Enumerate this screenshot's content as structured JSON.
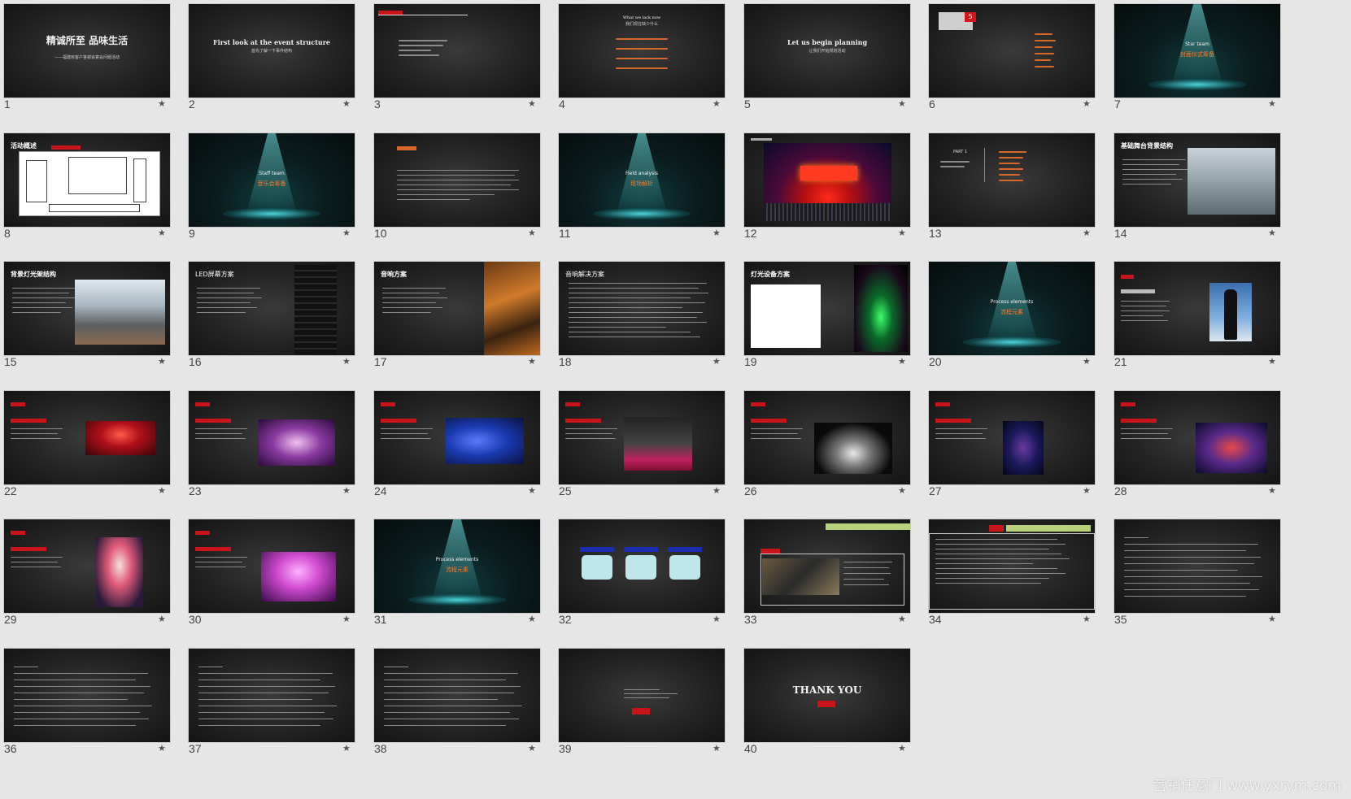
{
  "slides": [
    {
      "n": "1",
      "title": "精诚所至 品味生活",
      "sub": "——福建房客户答谢会宴会问题活动",
      "kind": "title"
    },
    {
      "n": "2",
      "title": "First look at the event structure",
      "sub": "首先了解一下事件结构",
      "kind": "title"
    },
    {
      "n": "3",
      "kind": "list"
    },
    {
      "n": "4",
      "title": "What we lack now",
      "sub": "我们现在缺少什么",
      "kind": "title-list"
    },
    {
      "n": "5",
      "title": "Let us begin planning",
      "sub": "让我们开始规划活动",
      "kind": "title"
    },
    {
      "n": "6",
      "badge": "5",
      "kind": "list-right"
    },
    {
      "n": "7",
      "title": "Star team",
      "sub": "封面仪式筹备",
      "kind": "spot"
    },
    {
      "n": "8",
      "title": "活动概述",
      "kind": "diagram"
    },
    {
      "n": "9",
      "title": "Staff team",
      "sub": "音乐会筹备",
      "kind": "spot"
    },
    {
      "n": "10",
      "title": "",
      "kind": "text"
    },
    {
      "n": "11",
      "title": "Field analysis",
      "sub": "现场解析",
      "kind": "spot"
    },
    {
      "n": "12",
      "title": "",
      "kind": "stage"
    },
    {
      "n": "13",
      "title": "PART 1",
      "kind": "part"
    },
    {
      "n": "14",
      "title": "基础舞台背景结构",
      "kind": "photo-right"
    },
    {
      "n": "15",
      "title": "背景灯光架结构",
      "kind": "photo-right"
    },
    {
      "n": "16",
      "title": "LED屏幕方案",
      "kind": "photo-right-dark"
    },
    {
      "n": "17",
      "title": "音响方案",
      "kind": "photo-right-orange"
    },
    {
      "n": "18",
      "title": "音响解决方案",
      "kind": "text"
    },
    {
      "n": "19",
      "title": "灯光设备方案",
      "kind": "photo-right-green"
    },
    {
      "n": "20",
      "title": "Process elements",
      "sub": "流程元素",
      "kind": "spot"
    },
    {
      "n": "21",
      "title": "",
      "kind": "person"
    },
    {
      "n": "22",
      "title": "",
      "kind": "photo-mid-red"
    },
    {
      "n": "23",
      "title": "",
      "kind": "photo-mid-purple"
    },
    {
      "n": "24",
      "title": "",
      "kind": "photo-mid-blue"
    },
    {
      "n": "25",
      "title": "",
      "kind": "photo-mid-pink"
    },
    {
      "n": "26",
      "title": "",
      "kind": "photo-mid-white"
    },
    {
      "n": "27",
      "title": "",
      "kind": "photo-mid-navy"
    },
    {
      "n": "28",
      "title": "",
      "kind": "photo-mid-red2"
    },
    {
      "n": "29",
      "title": "",
      "kind": "photo-mid-opera"
    },
    {
      "n": "30",
      "title": "",
      "kind": "photo-mid-pink2"
    },
    {
      "n": "31",
      "title": "Process elements",
      "sub": "流程元素",
      "kind": "spot"
    },
    {
      "n": "32",
      "title": "",
      "kind": "cards"
    },
    {
      "n": "33",
      "title": "",
      "kind": "banner"
    },
    {
      "n": "34",
      "title": "",
      "kind": "bordered"
    },
    {
      "n": "35",
      "title": "",
      "kind": "text"
    },
    {
      "n": "36",
      "title": "",
      "kind": "text"
    },
    {
      "n": "37",
      "title": "",
      "kind": "text"
    },
    {
      "n": "38",
      "title": "",
      "kind": "text"
    },
    {
      "n": "39",
      "title": "",
      "kind": "end"
    },
    {
      "n": "40",
      "title": "THANK YOU",
      "kind": "thanks"
    }
  ],
  "watermark": "营销任意门 www.yxrym.com",
  "colors": {
    "background": "#e6e6e6",
    "accent_orange": "#ff7a2a",
    "accent_red": "#d8141b",
    "spot_cyan": "#50e6eb"
  }
}
